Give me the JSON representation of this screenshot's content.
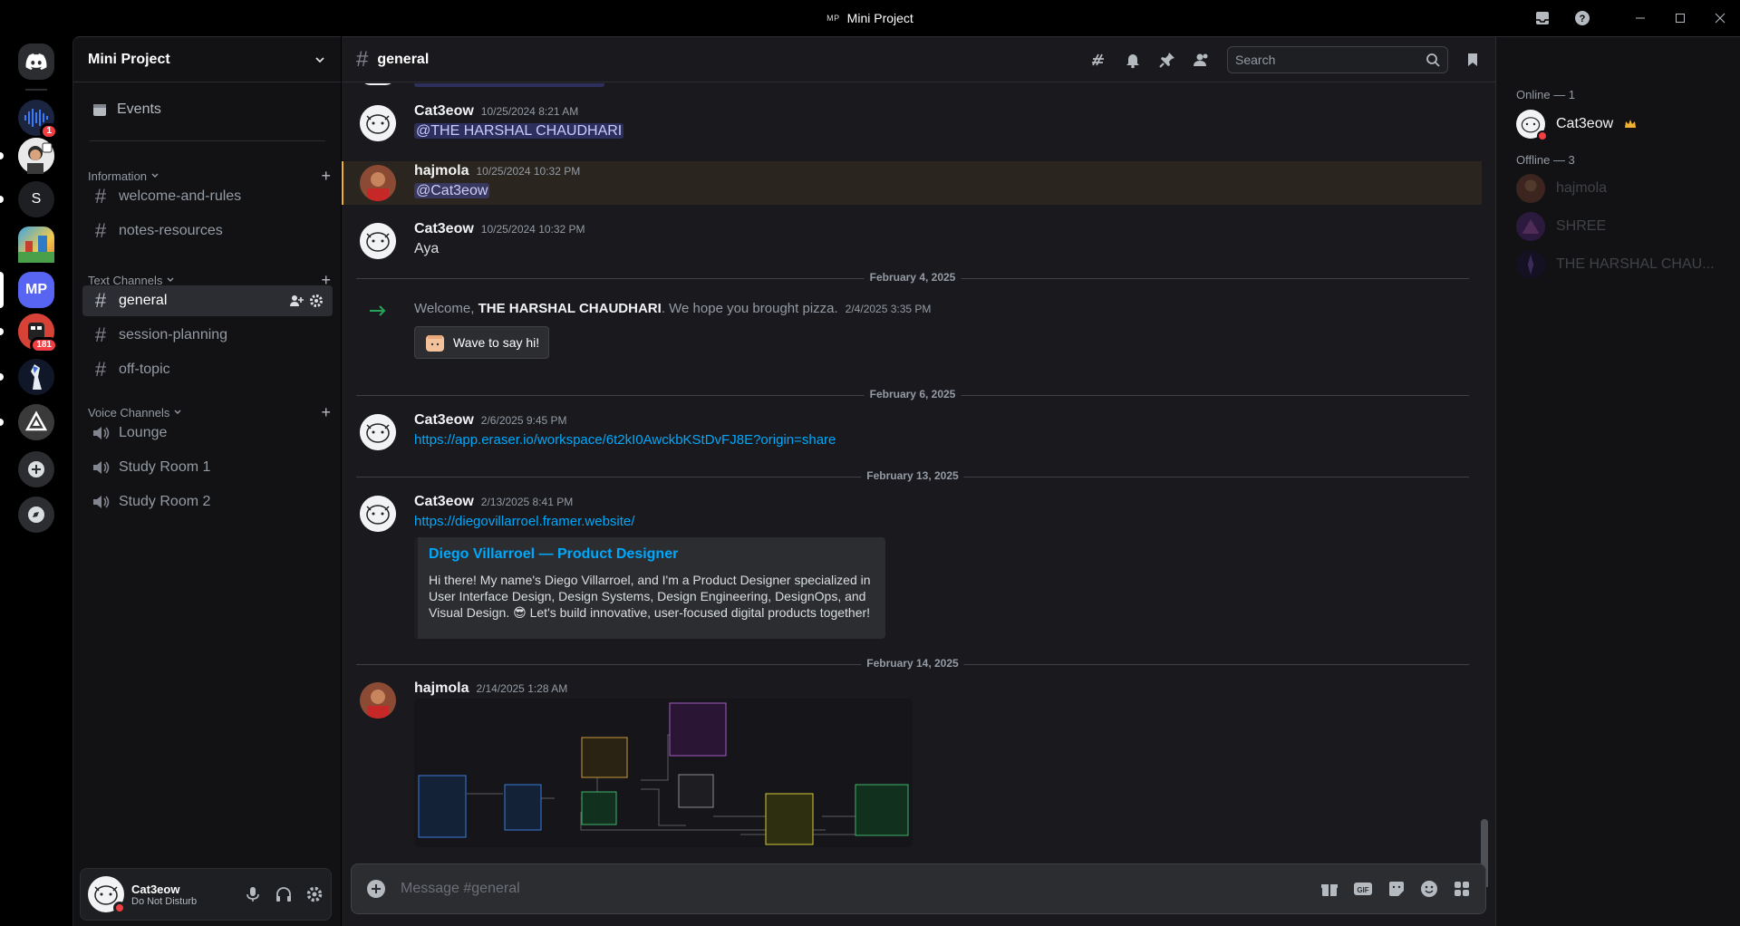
{
  "window": {
    "title": "Mini Project",
    "abbrev": "MP"
  },
  "rail": {
    "servers": [
      {
        "name": "discord-home"
      },
      {
        "name": "voice-server",
        "badge": "1"
      },
      {
        "name": "avatar-server"
      },
      {
        "name": "S"
      },
      {
        "name": "game-server"
      },
      {
        "name": "MP"
      },
      {
        "name": "red-server",
        "badge": "181"
      },
      {
        "name": "anime-server"
      },
      {
        "name": "triangle-server"
      }
    ]
  },
  "sidebar": {
    "guild_name": "Mini Project",
    "events_label": "Events",
    "categories": [
      {
        "label": "Information",
        "channels": [
          "welcome-and-rules",
          "notes-resources"
        ]
      },
      {
        "label": "Text Channels",
        "channels": [
          "general",
          "session-planning",
          "off-topic"
        ]
      },
      {
        "label": "Voice Channels",
        "channels": [
          "Lounge",
          "Study Room 1",
          "Study Room 2"
        ]
      }
    ],
    "active_channel": "general"
  },
  "user": {
    "name": "Cat3eow",
    "status": "Do Not Disturb"
  },
  "chat": {
    "channel": "general",
    "search_placeholder": "Search",
    "composer_placeholder": "Message #general",
    "messages": [
      {
        "author": "Cat3eow",
        "time": "10/25/2024 8:21 AM",
        "text": "@THE HARSHAL CHAUDHARI"
      },
      {
        "author": "hajmola",
        "time": "10/25/2024 10:32 PM",
        "text": "@Cat3eow"
      },
      {
        "author": "Cat3eow",
        "time": "10/25/2024 10:32 PM",
        "text": "Aya"
      },
      {
        "divider": "February 4, 2025"
      },
      {
        "system_pre": "Welcome, ",
        "system_name": "THE HARSHAL CHAUDHARI",
        "system_post": ". We hope you brought pizza.",
        "time": "2/4/2025 3:35 PM",
        "button": "Wave to say hi!"
      },
      {
        "divider": "February 6, 2025"
      },
      {
        "author": "Cat3eow",
        "time": "2/6/2025 9:45 PM",
        "text": "https://app.eraser.io/workspace/6t2kI0AwckbKStDvFJ8E?origin=share"
      },
      {
        "divider": "February 13, 2025"
      },
      {
        "author": "Cat3eow",
        "time": "2/13/2025 8:41 PM",
        "text": "https://diegovillarroel.framer.website/",
        "embed_title": "Diego Villarroel — Product Designer",
        "embed_desc": "Hi there! My name's Diego Villarroel, and I'm a Product Designer specialized in User Interface Design, Design Systems, Design Engineering, DesignOps, and Visual Design. 😎 Let's build innovative, user-focused digital products together!"
      },
      {
        "divider": "February 14, 2025"
      },
      {
        "author": "hajmola",
        "time": "2/14/2025 1:28 AM"
      }
    ]
  },
  "members": {
    "online_label": "Online — 1",
    "offline_label": "Offline — 3",
    "online": [
      "Cat3eow"
    ],
    "offline": [
      "hajmola",
      "SHREE",
      "THE HARSHAL CHAU..."
    ]
  },
  "colors": {
    "accent": "#5865f2",
    "dnd": "#f23f43",
    "link": "#00a8fc",
    "highlight": "#f0b132"
  }
}
